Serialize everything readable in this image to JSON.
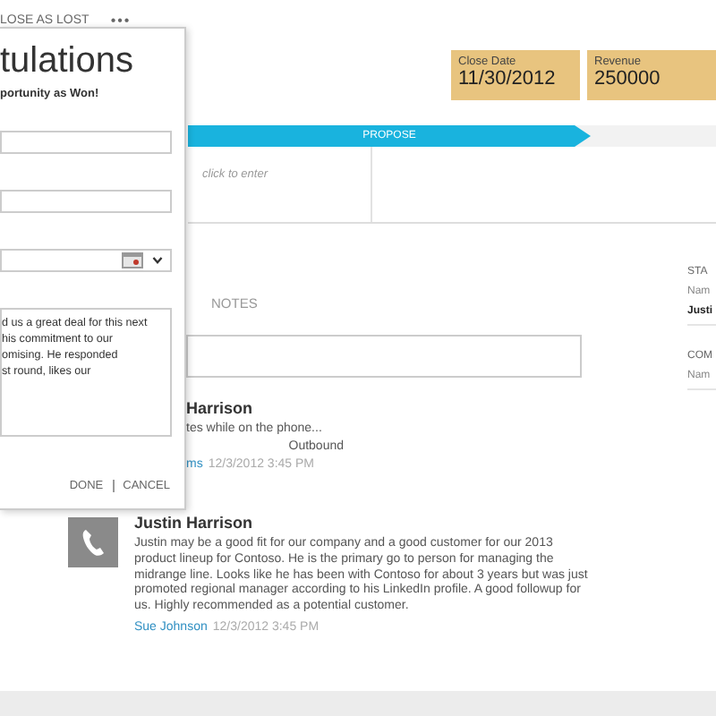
{
  "top_bar": {
    "command": "LOSE AS LOST",
    "more": "•••"
  },
  "tiles": [
    {
      "label": "Close Date",
      "value": "11/30/2012"
    },
    {
      "label": "Revenue",
      "value": "250000"
    }
  ],
  "process": {
    "stages": [
      {
        "label": "PROPOSE",
        "selected": true
      }
    ]
  },
  "detail": {
    "placeholder": "click to enter"
  },
  "tabs": [
    {
      "label": "NOTES",
      "selected": false
    }
  ],
  "notes": [
    {
      "kind": "plain",
      "author": "Harrison",
      "text": "tes while on the phone...",
      "direction": "Outbound",
      "by": "ms",
      "time": "12/3/2012 3:45 PM"
    },
    {
      "kind": "phone",
      "author": "Justin Harrison",
      "text": "Justin may be a good fit for our company and a good customer for our 2013 product lineup for Contoso. He is the primary go to person for managing the midrange line. Looks like he has been with Contoso for about 3 years but was just promoted regional manager according to his LinkedIn profile. A good followup for us. Highly recommended as a potential customer.",
      "by": "Sue Johnson",
      "time": "12/3/2012 3:45 PM"
    }
  ],
  "side": [
    {
      "heading": "STA",
      "label": "Nam",
      "value": "Justi"
    },
    {
      "heading": "COM",
      "label": "Nam"
    }
  ],
  "dialog": {
    "title": "tulations",
    "subtitle": "portunity as Won!",
    "fields": [
      {
        "kind": "text"
      },
      {
        "kind": "text"
      },
      {
        "kind": "date"
      }
    ],
    "description": [
      "d us a great deal for this next",
      "his commitment to our",
      "omising. He responded",
      "st round, likes our"
    ],
    "buttons": [
      "DONE",
      "CANCEL"
    ]
  }
}
